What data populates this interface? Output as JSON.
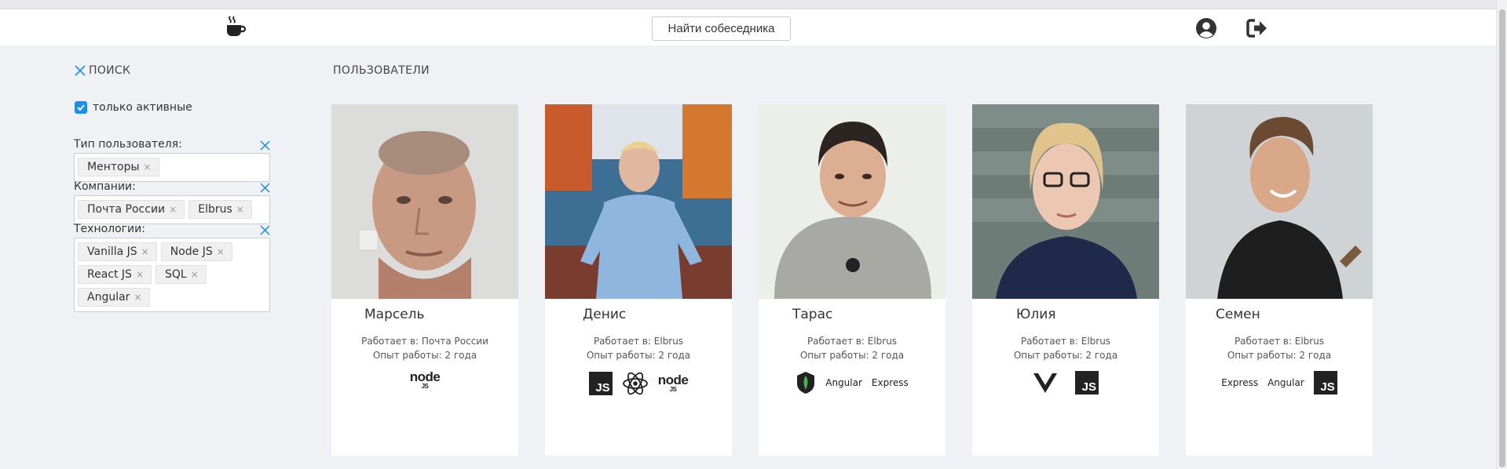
{
  "header": {
    "logo_icon": "coffee-cup-icon",
    "find_button_label": "Найти собеседника",
    "profile_icon": "user-circle-icon",
    "logout_icon": "sign-out-icon"
  },
  "sidebar": {
    "search_title": "ПОИСК",
    "active_only_label": "только активные",
    "active_only_checked": true,
    "filters": [
      {
        "label": "Тип пользователя:",
        "tags": [
          "Менторы"
        ]
      },
      {
        "label": "Компании:",
        "tags": [
          "Почта России",
          "Elbrus"
        ]
      },
      {
        "label": "Технологии:",
        "tags": [
          "Vanilla JS",
          "Node JS",
          "React JS",
          "SQL",
          "Angular"
        ]
      }
    ]
  },
  "main": {
    "title": "ПОЛЬЗОВАТЕЛИ",
    "users": [
      {
        "name": "Марсель",
        "work": "Работает в: Почта России",
        "experience": "Опыт работы: 2 года",
        "tech": [
          "node"
        ]
      },
      {
        "name": "Денис",
        "work": "Работает в: Elbrus",
        "experience": "Опыт работы: 2 года",
        "tech": [
          "JS",
          "react",
          "node"
        ]
      },
      {
        "name": "Тарас",
        "work": "Работает в: Elbrus",
        "experience": "Опыт работы: 2 года",
        "tech": [
          "mongodb",
          "Angular",
          "Express"
        ]
      },
      {
        "name": "Юлия",
        "work": "Работает в: Elbrus",
        "experience": "Опыт работы: 2 года",
        "tech": [
          "vue",
          "JS"
        ]
      },
      {
        "name": "Семен",
        "work": "Работает в: Elbrus",
        "experience": "Опыт работы: 2 года",
        "tech": [
          "Express",
          "Angular",
          "JS"
        ]
      }
    ]
  },
  "colors": {
    "background": "#f0f1f5",
    "accent": "#1a8ef0"
  }
}
